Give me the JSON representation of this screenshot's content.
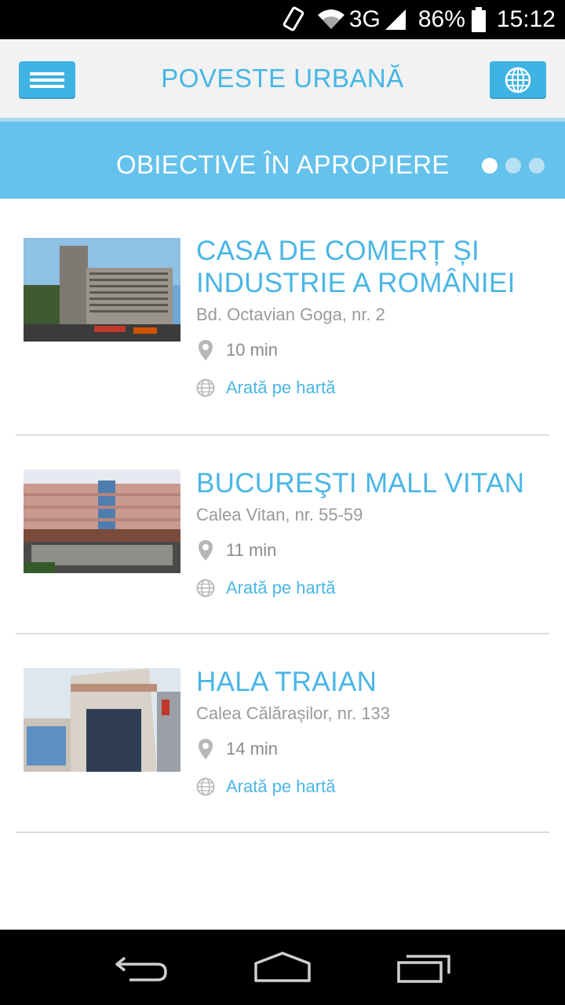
{
  "status_bar": {
    "network": "3G",
    "battery": "86%",
    "time": "15:12",
    "icons": [
      "rotate-icon",
      "wifi-icon",
      "signal-icon",
      "battery-icon"
    ]
  },
  "header": {
    "title": "POVESTE URBANĂ",
    "menu_icon": "hamburger-icon",
    "globe_icon": "globe-icon",
    "accent_color": "#3fb3e3"
  },
  "section": {
    "title": "OBIECTIVE ÎN APROPIERE",
    "page_dots": 3,
    "active_dot": 1,
    "background_color": "#64c2ec"
  },
  "items": [
    {
      "title": "CASA DE COMERȚ ȘI INDUSTRIE A ROMÂNIEI",
      "title_lines": [
        "CASA DE COMERȚ ȘI",
        "INDUSTRIE A ROMÂNIEI"
      ],
      "address": "Bd. Octavian Goga, nr. 2",
      "time": "10 min",
      "map_link": "Arată pe hartă"
    },
    {
      "title": "BUCUREȘTI MALL VITAN",
      "title_lines": [
        "BUCUREŞTI MALL VITAN"
      ],
      "address": "Calea Vitan, nr. 55-59",
      "time": "11 min",
      "map_link": "Arată pe hartă"
    },
    {
      "title": "HALA TRAIAN",
      "title_lines": [
        "HALA TRAIAN"
      ],
      "address": "Calea Călărașilor, nr. 133",
      "time": "14 min",
      "map_link": "Arată pe hartă"
    }
  ],
  "nav_bar": {
    "icons": [
      "back-icon",
      "home-icon",
      "recent-apps-icon"
    ]
  }
}
